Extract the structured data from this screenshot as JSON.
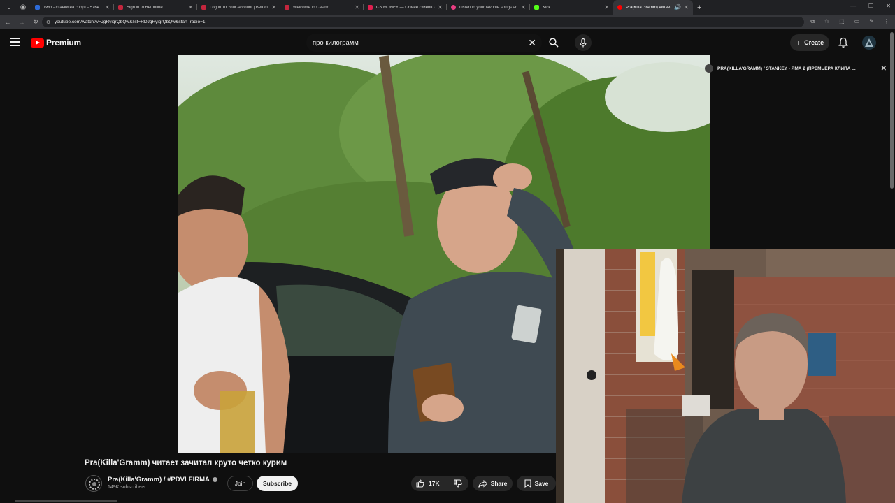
{
  "browser": {
    "tabs": [
      {
        "title": "1win - ставки на спорт - 5764",
        "color": "#2d6bd8"
      },
      {
        "title": "Sign in to Betonline",
        "color": "#c4263d"
      },
      {
        "title": "Log in To Your Account | BetOnl",
        "color": "#c4263d"
      },
      {
        "title": "Welcome to Casino.",
        "color": "#c4263d"
      },
      {
        "title": "CS.MONEY — Обмен скинов CS",
        "color": "#e01f4f"
      },
      {
        "title": "Listen to your favorite songs an",
        "color": "#e93d82"
      },
      {
        "title": "Kick",
        "color": "#53fc18"
      },
      {
        "title": "Pra(Killa'Gramm) читает зач",
        "color": "#ff0000"
      }
    ],
    "url": "youtube.com/watch?v=JgRyigrQbQw&list=RDJgRyigrQbQw&start_radio=1"
  },
  "header": {
    "brand": "Premium",
    "search_value": "про килограмм",
    "create_label": "Create"
  },
  "playlist": {
    "title": "PRA(KILLA'GRAMM) / STANKEY - ЯМА 2 (ПРЕМЬЕРА КЛИПА ..."
  },
  "video": {
    "title": "Pra(Killa'Gramm) читает зачитал круто четко курим",
    "channel_name": "Pra(Killa'Gramm) / #PDVLFIRMA",
    "subscribers": "149K subscribers",
    "join_label": "Join",
    "subscribe_label": "Subscribe",
    "likes": "17K",
    "share_label": "Share",
    "save_label": "Save"
  },
  "colors": {
    "accent": "#ff0000",
    "background": "#0f0f0f"
  }
}
